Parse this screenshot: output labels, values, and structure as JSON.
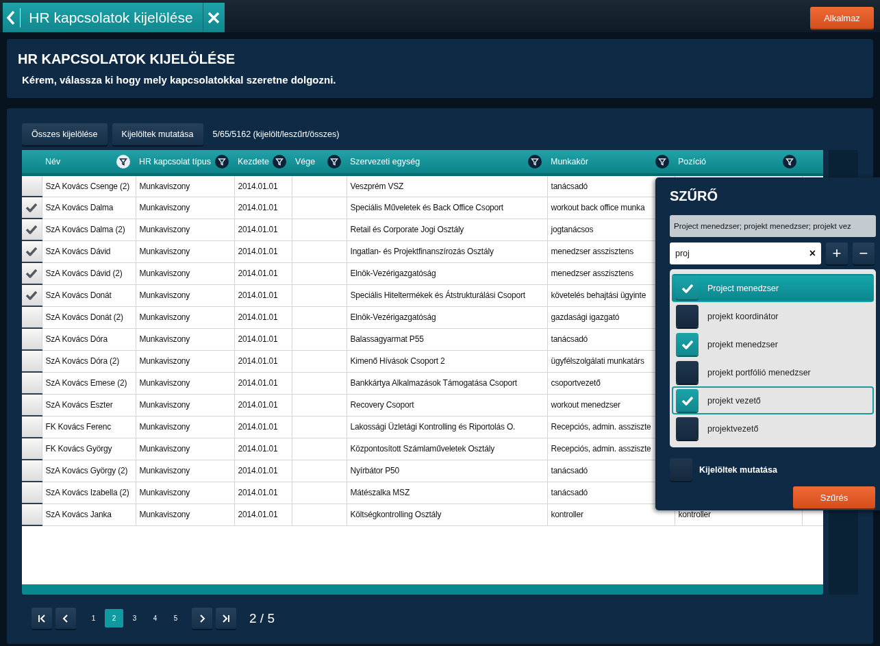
{
  "tab": {
    "title": "HR kapcsolatok kijelölése"
  },
  "apply_button": "Alkalmaz",
  "header": {
    "title": "HR KAPCSOLATOK KIJELÖLÉSE",
    "subtitle": "Kérem, válassza ki hogy mely kapcsolatokkal szeretne dolgozni."
  },
  "toolbar": {
    "buttons": [
      "Összes kijelölése",
      "Kijelöltek mutatása"
    ],
    "counter": "5/65/5162 (kijelölt/leszűrt/összes)"
  },
  "table": {
    "columns": [
      {
        "label": "Név",
        "filter_active": true
      },
      {
        "label": "HR kapcsolat típus",
        "filter_active": false
      },
      {
        "label": "Kezdete",
        "filter_active": false
      },
      {
        "label": "Vége",
        "filter_active": false
      },
      {
        "label": "Szervezeti egység",
        "filter_active": false
      },
      {
        "label": "Munkakör",
        "filter_active": false
      },
      {
        "label": "Pozíció",
        "filter_active": false
      }
    ],
    "rows": [
      {
        "checked": false,
        "name": "SzA Kovács Csenge (2)",
        "type": "Munkaviszony",
        "start": "2014.01.01",
        "unit": "Veszprém VSZ",
        "job": "tanácsadó"
      },
      {
        "checked": true,
        "name": "SzA Kovács Dalma",
        "type": "Munkaviszony",
        "start": "2014.01.01",
        "unit": "Speciális Műveletek és Back Office Csoport",
        "job": "workout back office munka"
      },
      {
        "checked": true,
        "name": "SzA Kovács Dalma (2)",
        "type": "Munkaviszony",
        "start": "2014.01.01",
        "unit": "Retail és Corporate Jogi Osztály",
        "job": "jogtanácsos"
      },
      {
        "checked": true,
        "name": "SzA Kovács Dávid",
        "type": "Munkaviszony",
        "start": "2014.01.01",
        "unit": "Ingatlan- és Projektfinanszírozás Osztály",
        "job": "menedzser asszisztens"
      },
      {
        "checked": true,
        "name": "SzA Kovács Dávid (2)",
        "type": "Munkaviszony",
        "start": "2014.01.01",
        "unit": "Elnök-Vezérigazgatóság",
        "job": "menedzser asszisztens"
      },
      {
        "checked": true,
        "name": "SzA Kovács Donát",
        "type": "Munkaviszony",
        "start": "2014.01.01",
        "unit": "Speciális Hiteltermékek és Átstrukturálási Csoport",
        "job": "követelés behajtási ügyinte"
      },
      {
        "checked": false,
        "name": "SzA Kovács Donát (2)",
        "type": "Munkaviszony",
        "start": "2014.01.01",
        "unit": "Elnök-Vezérigazgatóság",
        "job": "gazdasági igazgató"
      },
      {
        "checked": false,
        "name": "SzA Kovács Dóra",
        "type": "Munkaviszony",
        "start": "2014.01.01",
        "unit": "Balassagyarmat P55",
        "job": "tanácsadó"
      },
      {
        "checked": false,
        "name": "SzA Kovács Dóra (2)",
        "type": "Munkaviszony",
        "start": "2014.01.01",
        "unit": "Kimenő Hívások Csoport 2",
        "job": "ügyfélszolgálati munkatárs"
      },
      {
        "checked": false,
        "name": "SzA Kovács Emese (2)",
        "type": "Munkaviszony",
        "start": "2014.01.01",
        "unit": "Bankkártya Alkalmazások Támogatása Csoport",
        "job": "csoportvezető"
      },
      {
        "checked": false,
        "name": "SzA Kovács Eszter",
        "type": "Munkaviszony",
        "start": "2014.01.01",
        "unit": "Recovery Csoport",
        "job": "workout menedzser"
      },
      {
        "checked": false,
        "name": "FK Kovács Ferenc",
        "type": "Munkaviszony",
        "start": "2014.01.01",
        "unit": "Lakossági Üzletági Kontrolling és Riportolás O.",
        "job": "Recepciós, admin. assziszte"
      },
      {
        "checked": false,
        "name": "FK Kovács György",
        "type": "Munkaviszony",
        "start": "2014.01.01",
        "unit": "Központosított Számlaműveletek Osztály",
        "job": "Recepciós, admin. assziszte"
      },
      {
        "checked": false,
        "name": "SzA Kovács György (2)",
        "type": "Munkaviszony",
        "start": "2014.01.01",
        "unit": "Nyírbátor P50",
        "job": "tanácsadó"
      },
      {
        "checked": false,
        "name": "SzA Kovács Izabella (2)",
        "type": "Munkaviszony",
        "start": "2014.01.01",
        "unit": "Mátészalka MSZ",
        "job": "tanácsadó"
      },
      {
        "checked": false,
        "name": "SzA Kovács Janka",
        "type": "Munkaviszony",
        "start": "2014.01.01",
        "unit": "Költségkontrolling Osztály",
        "job": "kontroller",
        "position": "kontroller"
      }
    ]
  },
  "pagination": {
    "pages": [
      {
        "label": "1",
        "selected": false
      },
      {
        "label": "2",
        "selected": true
      },
      {
        "label": "3",
        "selected": false
      },
      {
        "label": "4",
        "selected": false
      },
      {
        "label": "5",
        "selected": false
      }
    ],
    "status": "2 / 5"
  },
  "filter": {
    "title": "SZŰRŐ",
    "summary": "Project menedzser; projekt menedzser; projekt vez",
    "search": {
      "value": "proj",
      "clear": "×"
    },
    "add": "+",
    "remove": "−",
    "items": [
      {
        "label": "Project menedzser",
        "checked": true,
        "selected": true,
        "focused": false
      },
      {
        "label": "projekt koordinátor",
        "checked": false,
        "selected": false,
        "focused": false
      },
      {
        "label": "projekt menedzser",
        "checked": true,
        "selected": false,
        "focused": false
      },
      {
        "label": "projekt portfólió menedzser",
        "checked": false,
        "selected": false,
        "focused": false
      },
      {
        "label": "projekt vezető",
        "checked": true,
        "selected": false,
        "focused": true
      },
      {
        "label": "projektvezető",
        "checked": false,
        "selected": false,
        "focused": false
      }
    ],
    "show_selected": {
      "label": "Kijelöltek mutatása",
      "checked": false
    },
    "button": "Szűrés"
  }
}
